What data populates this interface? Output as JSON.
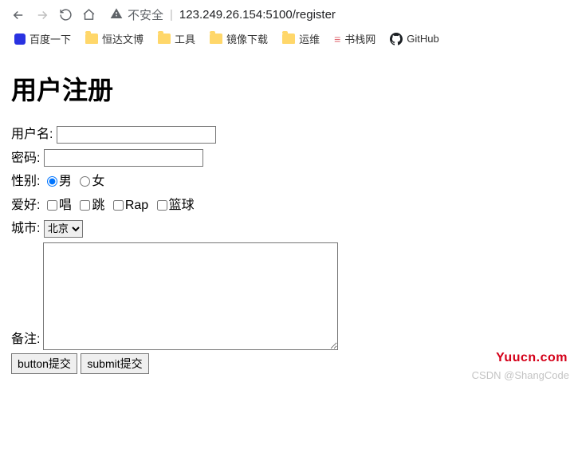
{
  "browser": {
    "insecure_label": "不安全",
    "url": "123.249.26.154:5100/register"
  },
  "bookmarks": [
    "百度一下",
    "恒达文博",
    "工具",
    "镜像下载",
    "运维",
    "书栈网",
    "GitHub"
  ],
  "page": {
    "title": "用户注册",
    "labels": {
      "username": "用户名:",
      "password": "密码:",
      "gender": "性别:",
      "hobby": "爱好:",
      "city": "城市:",
      "remark": "备注:"
    },
    "gender_options": [
      "男",
      "女"
    ],
    "hobby_options": [
      "唱",
      "跳",
      "Rap",
      "篮球"
    ],
    "city_selected": "北京",
    "buttons": {
      "btn": "button提交",
      "submit": "submit提交"
    }
  },
  "watermarks": {
    "site": "Yuucn.com",
    "author": "CSDN @ShangCode"
  }
}
